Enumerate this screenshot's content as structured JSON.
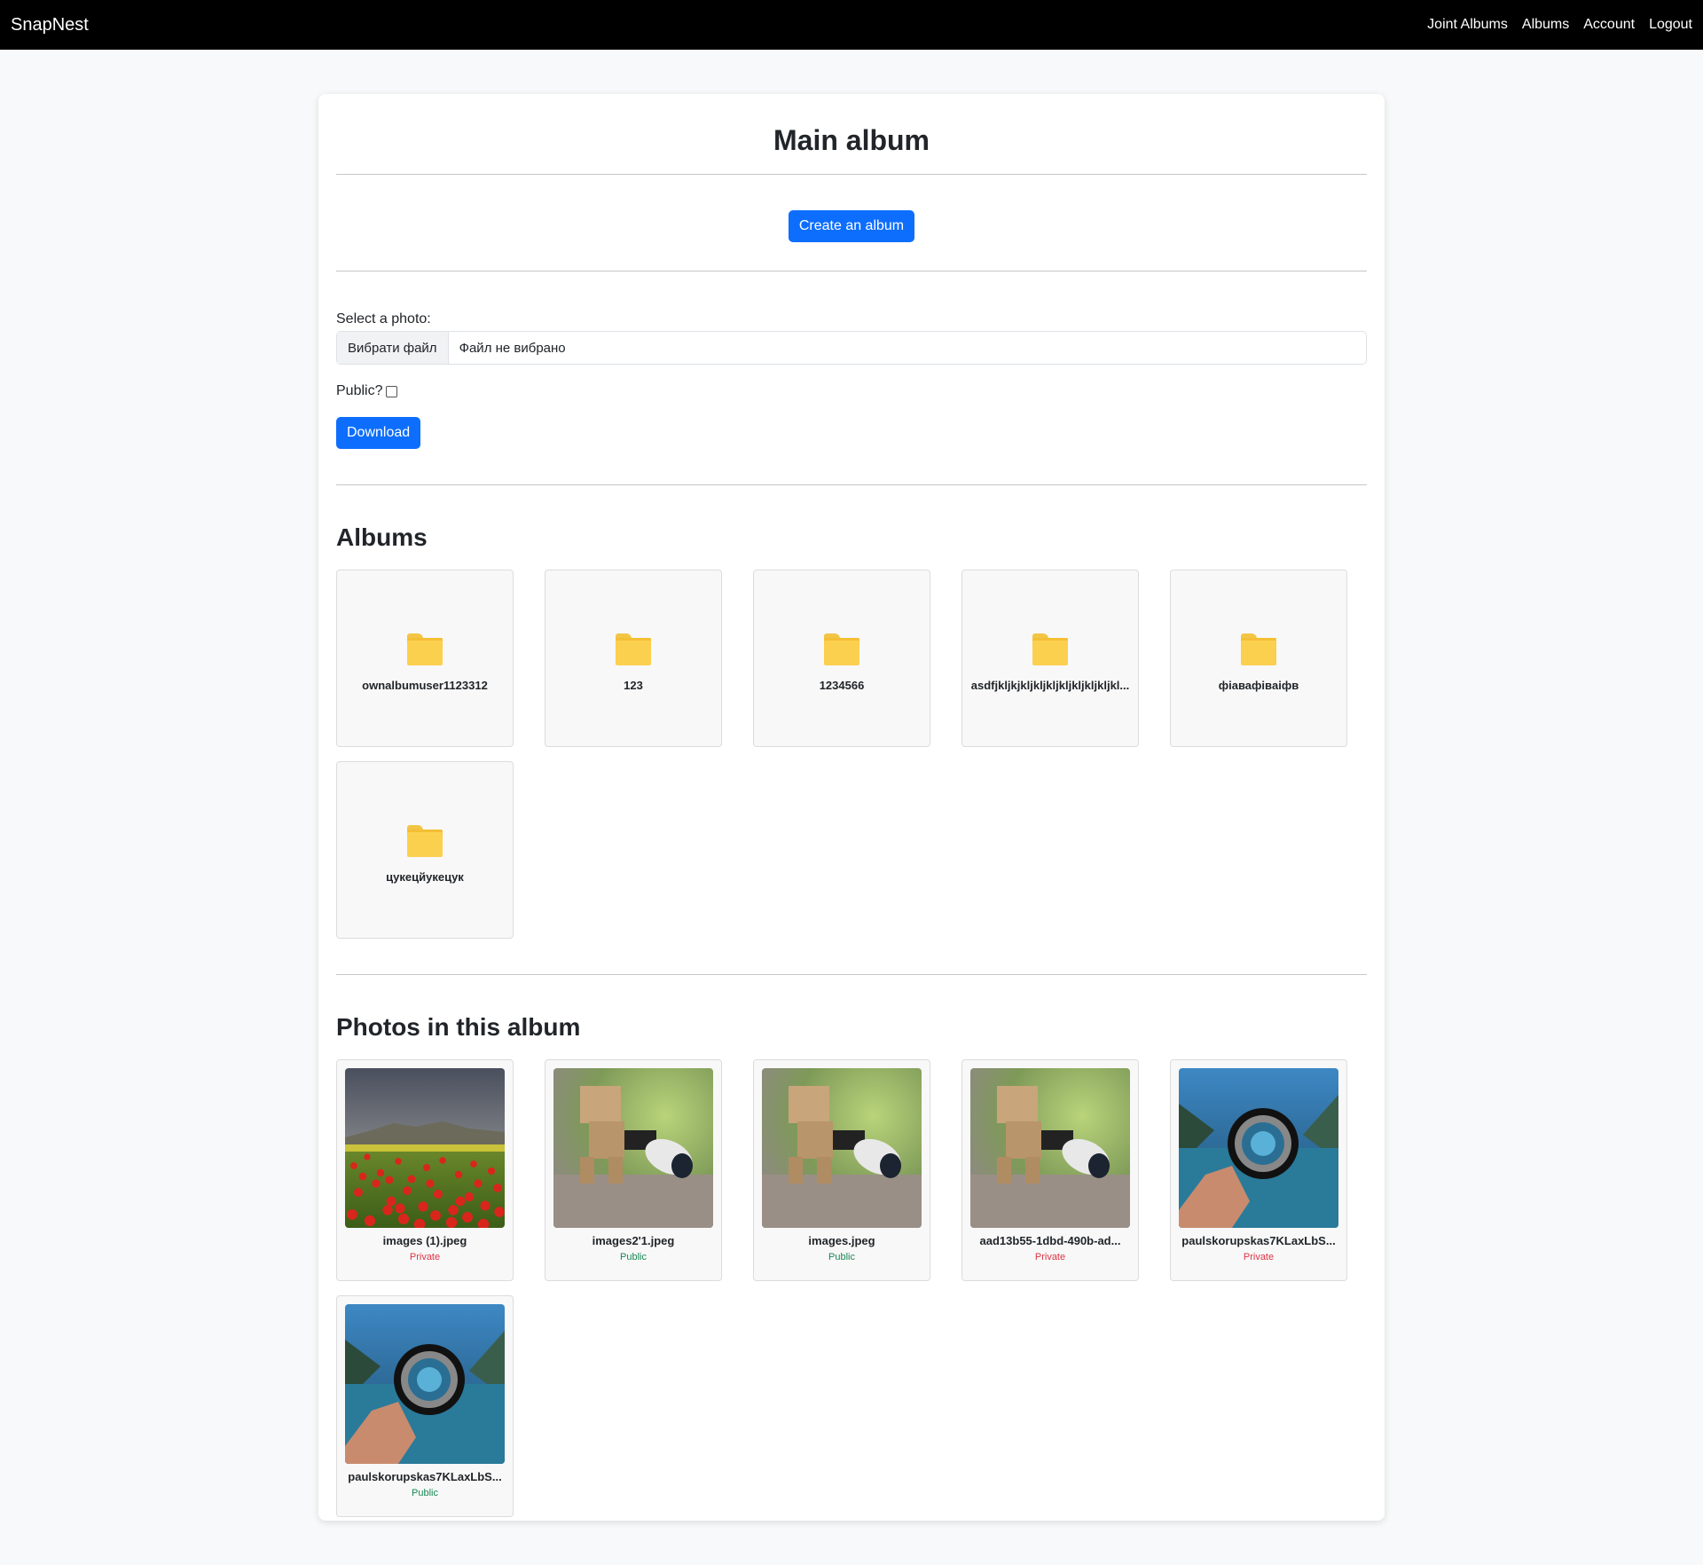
{
  "navbar": {
    "brand": "SnapNest",
    "links": [
      "Joint Albums",
      "Albums",
      "Account",
      "Logout"
    ]
  },
  "page": {
    "title": "Main album",
    "create_album_label": "Create an album"
  },
  "upload": {
    "select_label": "Select a photo:",
    "file_button": "Вибрати файл",
    "file_status": "Файл не вибрано",
    "public_label": "Public?",
    "public_checked": false,
    "download_label": "Download"
  },
  "albums": {
    "heading": "Albums",
    "items": [
      {
        "name": "ownalbumuser1123312"
      },
      {
        "name": "123"
      },
      {
        "name": "1234566"
      },
      {
        "name": "asdfjkljkjkljkljkljkljkljkljkljkl..."
      },
      {
        "name": "фіавафівaіфв"
      },
      {
        "name": "цукецйукецук"
      }
    ]
  },
  "photos": {
    "heading": "Photos in this album",
    "items": [
      {
        "name": "images (1).jpeg",
        "status": "Private",
        "image": "poppy-field"
      },
      {
        "name": "images2'1.jpeg",
        "status": "Public",
        "image": "cardboard-robot-camera"
      },
      {
        "name": "images.jpeg",
        "status": "Public",
        "image": "cardboard-robot-camera"
      },
      {
        "name": "aad13b55-1dbd-490b-ad...",
        "status": "Private",
        "image": "cardboard-robot-camera"
      },
      {
        "name": "paulskorupskas7KLaxLbS...",
        "status": "Private",
        "image": "hand-lens-lake"
      },
      {
        "name": "paulskorupskas7KLaxLbS...",
        "status": "Public",
        "image": "hand-lens-lake"
      }
    ]
  },
  "colors": {
    "accent": "#0d6efd",
    "private": "#dc3545",
    "public": "#198754",
    "navbar": "#000000"
  }
}
